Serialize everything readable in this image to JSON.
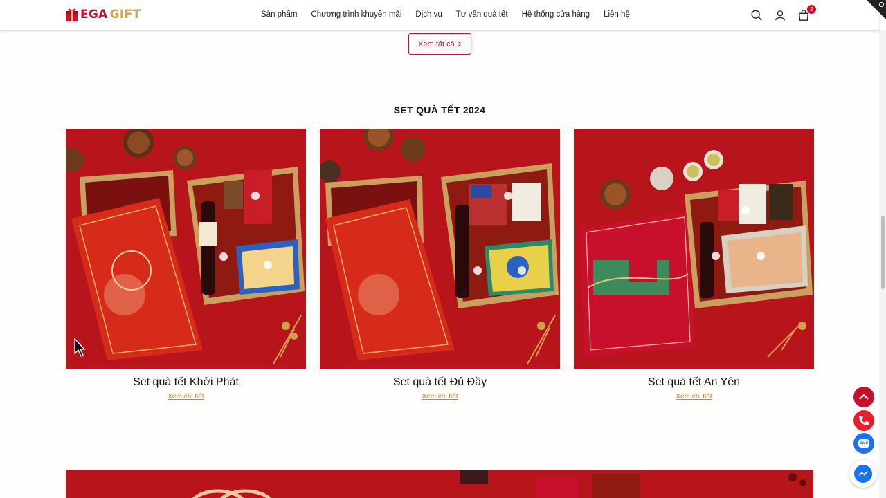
{
  "brand": {
    "logo_ega": "EGA",
    "logo_gift": "GIFT"
  },
  "nav": {
    "items": [
      "Sản phẩm",
      "Chương trình khuyến mãi",
      "Dịch vụ",
      "Tư vấn quà tết",
      "Hệ thống cửa hàng",
      "Liên hệ"
    ]
  },
  "header": {
    "cart_count": "2"
  },
  "view_all": {
    "label": "Xem tất cả"
  },
  "section": {
    "title": "SET QUÀ TẾT 2024"
  },
  "products": [
    {
      "name": "Set quà tết Khởi Phát",
      "link": "Xem chi tiết"
    },
    {
      "name": "Set quà tết Đủ Đầy",
      "link": "Xem chi tiết"
    },
    {
      "name": "Set quà tết An Yên",
      "link": "Xem chi tiết"
    }
  ],
  "floating": {
    "zalo_label": "Zalo"
  },
  "colors": {
    "brand_red": "#c8102e",
    "link_orange": "#e07a1a",
    "image_red": "#b8141c",
    "messenger_blue": "#1a73e8"
  }
}
